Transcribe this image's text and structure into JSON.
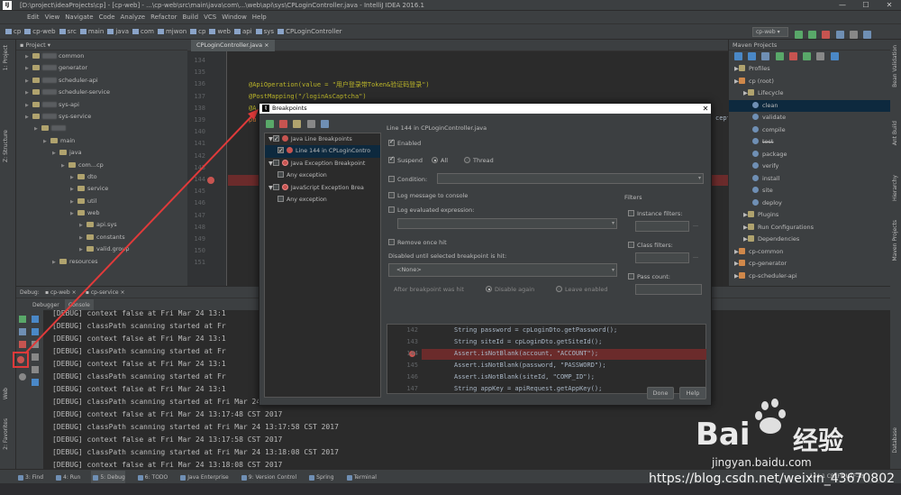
{
  "window": {
    "title": "[D:\\project\\ideaProjects\\cp] - [cp-web] - ...\\cp-web\\src\\main\\java\\com\\...\\web\\api\\sys\\CPLoginController.java - IntelliJ IDEA 2016.1",
    "min": "—",
    "max": "☐",
    "close": "✕"
  },
  "menu": [
    "Edit",
    "View",
    "Navigate",
    "Code",
    "Analyze",
    "Refactor",
    "Build",
    "VCS",
    "Window",
    "Help"
  ],
  "breadcrumbs": [
    "cp",
    "cp-web",
    "src",
    "main",
    "java",
    "com",
    "mjwon",
    "cp",
    "web",
    "api",
    "sys",
    "CPLoginController"
  ],
  "run_config": "cp-web",
  "project_panel": {
    "header": "Project",
    "items": [
      {
        "label": "common",
        "indent": 0
      },
      {
        "label": "generator",
        "indent": 0
      },
      {
        "label": "scheduler-api",
        "indent": 0
      },
      {
        "label": "scheduler-service",
        "indent": 0
      },
      {
        "label": "sys-api",
        "indent": 0
      },
      {
        "label": "sys-service",
        "indent": 0
      },
      {
        "label": "",
        "indent": 1
      },
      {
        "label": "main",
        "indent": 2
      },
      {
        "label": "java",
        "indent": 3
      },
      {
        "label": "com...cp",
        "indent": 4
      },
      {
        "label": "dto",
        "indent": 5
      },
      {
        "label": "service",
        "indent": 5
      },
      {
        "label": "util",
        "indent": 5
      },
      {
        "label": "web",
        "indent": 5
      },
      {
        "label": "api.sys",
        "indent": 6
      },
      {
        "label": "constants",
        "indent": 6
      },
      {
        "label": "valid.group",
        "indent": 6
      },
      {
        "label": "resources",
        "indent": 3
      }
    ]
  },
  "editor": {
    "tab": "CPLoginController.java",
    "lines": [
      {
        "n": "134",
        "code": ""
      },
      {
        "n": "135",
        "code": ""
      },
      {
        "n": "136",
        "code": "@ApiOperation(value = \"用户登录带Token&验证码登录\")"
      },
      {
        "n": "137",
        "code": "@PostMapping(\"/loginAsCaptcha\")"
      },
      {
        "n": "138",
        "code": "@A"
      },
      {
        "n": "139",
        "code": "pu"
      },
      {
        "n": "140",
        "code": ""
      },
      {
        "n": "141",
        "code": ""
      },
      {
        "n": "142",
        "code": ""
      },
      {
        "n": "143",
        "code": ""
      },
      {
        "n": "144",
        "code": ""
      },
      {
        "n": "145",
        "code": ""
      },
      {
        "n": "146",
        "code": ""
      },
      {
        "n": "147",
        "code": ""
      },
      {
        "n": "148",
        "code": ""
      },
      {
        "n": "149",
        "code": ""
      },
      {
        "n": "150",
        "code": ""
      },
      {
        "n": "151",
        "code": ""
      }
    ],
    "right_overflow": "cept"
  },
  "maven": {
    "header": "Maven Projects",
    "items": [
      {
        "label": "Profiles",
        "indent": 0,
        "kind": "folder"
      },
      {
        "label": "cp (root)",
        "indent": 0,
        "kind": "module"
      },
      {
        "label": "Lifecycle",
        "indent": 1,
        "kind": "folder"
      },
      {
        "label": "clean",
        "indent": 2,
        "kind": "goal",
        "selected": true
      },
      {
        "label": "validate",
        "indent": 2,
        "kind": "goal"
      },
      {
        "label": "compile",
        "indent": 2,
        "kind": "goal"
      },
      {
        "label": "test",
        "indent": 2,
        "kind": "goal",
        "strike": true
      },
      {
        "label": "package",
        "indent": 2,
        "kind": "goal"
      },
      {
        "label": "verify",
        "indent": 2,
        "kind": "goal"
      },
      {
        "label": "install",
        "indent": 2,
        "kind": "goal"
      },
      {
        "label": "site",
        "indent": 2,
        "kind": "goal"
      },
      {
        "label": "deploy",
        "indent": 2,
        "kind": "goal"
      },
      {
        "label": "Plugins",
        "indent": 1,
        "kind": "folder"
      },
      {
        "label": "Run Configurations",
        "indent": 1,
        "kind": "folder"
      },
      {
        "label": "Dependencies",
        "indent": 1,
        "kind": "folder"
      },
      {
        "label": "cp-common",
        "indent": 0,
        "kind": "module"
      },
      {
        "label": "cp-generator",
        "indent": 0,
        "kind": "module"
      },
      {
        "label": "cp-scheduler-api",
        "indent": 0,
        "kind": "module"
      }
    ]
  },
  "right_strip": [
    "Bean Validation",
    "Ant Build",
    "Hierarchy",
    "Maven Projects",
    "Database"
  ],
  "left_strip": [
    "1: Project",
    "Z: Structure",
    "Web",
    "2: Favorites"
  ],
  "debug": {
    "label": "Debug:",
    "sessions": [
      "cp-web",
      "cp-service"
    ],
    "tabs": [
      "Debugger",
      "Console"
    ]
  },
  "console": {
    "lines": [
      "[DEBUG] context false at Fri Mar 24 13:1",
      "[DEBUG] classPath scanning started at Fr",
      "[DEBUG] context false at Fri Mar 24 13:1",
      "[DEBUG] classPath scanning started at Fr",
      "[DEBUG] context false at Fri Mar 24 13:1",
      "[DEBUG] classPath scanning started at Fr",
      "[DEBUG] context false at Fri Mar 24 13:1",
      "[DEBUG] classPath scanning started at Fri Mar 24 13:17:48 CST 2017",
      "[DEBUG] context false at Fri Mar 24 13:17:48 CST 2017",
      "[DEBUG] classPath scanning started at Fri Mar 24 13:17:58 CST 2017",
      "[DEBUG] context false at Fri Mar 24 13:17:58 CST 2017",
      "[DEBUG] classPath scanning started at Fri Mar 24 13:18:08 CST 2017",
      "[DEBUG] context false at Fri Mar 24 13:18:08 CST 2017"
    ]
  },
  "statusbar": {
    "tabs": [
      "3: Find",
      "4: Run",
      "5: Debug",
      "6: TODO",
      "Java Enterprise",
      "9: Version Control",
      "Spring",
      "Terminal"
    ],
    "right": "144:1  CRLF$  UTF-8$"
  },
  "dialog": {
    "title": "Breakpoints",
    "tree": [
      {
        "label": "Java Line Breakpoints",
        "level": 0,
        "checked": true,
        "icon": "dot",
        "expanded": true
      },
      {
        "label": "Line 144 in CPLoginContro",
        "level": 1,
        "checked": true,
        "icon": "dot",
        "selected": true
      },
      {
        "label": "Java Exception Breakpoint",
        "level": 0,
        "checked": false,
        "icon": "bolt",
        "expanded": true
      },
      {
        "label": "Any exception",
        "level": 1,
        "checked": false,
        "icon": "none"
      },
      {
        "label": "JavaScript Exception Brea",
        "level": 0,
        "checked": false,
        "icon": "bolt",
        "expanded": true
      },
      {
        "label": "Any exception",
        "level": 1,
        "checked": false,
        "icon": "none"
      }
    ],
    "heading": "Line 144 in CPLoginController.java",
    "enabled": "Enabled",
    "suspend": "Suspend",
    "suspend_all": "All",
    "suspend_thread": "Thread",
    "condition": "Condition:",
    "log_message": "Log message to console",
    "log_expr": "Log evaluated expression:",
    "remove_once": "Remove once hit",
    "disabled_until": "Disabled until selected breakpoint is hit:",
    "none_option": "<None>",
    "after_hit": "After breakpoint was hit",
    "disable_again": "Disable again",
    "leave_enabled": "Leave enabled",
    "filters": "Filters",
    "instance_filters": "Instance filters:",
    "class_filters": "Class filters:",
    "pass_count": "Pass count:",
    "preview": [
      {
        "n": "142",
        "code": "String password = cpLoginDto.getPassword();"
      },
      {
        "n": "143",
        "code": "String siteId = cpLoginDto.getSiteId();"
      },
      {
        "n": "144",
        "code": "Assert.isNotBlank(account, \"ACCOUNT\");"
      },
      {
        "n": "145",
        "code": "Assert.isNotBlank(password, \"PASSWORD\");"
      },
      {
        "n": "146",
        "code": "Assert.isNotBlank(siteId, \"COMP_ID\");"
      },
      {
        "n": "147",
        "code": "String appKey = apiRequest.getAppKey();"
      }
    ],
    "done": "Done",
    "help": "Help"
  },
  "watermark": {
    "brand": "Bai",
    "brand2": "经验",
    "sub": "jingyan.baidu.com",
    "url": "https://blog.csdn.net/weixin_43670802"
  },
  "colors": {
    "accent": "#4a88c7",
    "breakpoint": "#c75450",
    "arrow": "#e03a3a"
  }
}
